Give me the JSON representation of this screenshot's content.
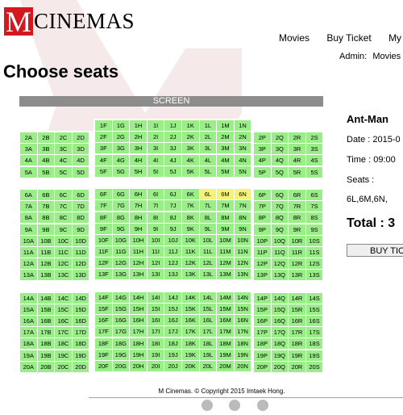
{
  "brand": {
    "logo_letter": "M",
    "logo_text": "CINEMAS",
    "accent": "#d4181f"
  },
  "nav": {
    "items": [
      "Movies",
      "Buy Ticket",
      "My Pa"
    ]
  },
  "admin": {
    "label": "Admin:",
    "link": "Movies"
  },
  "page": {
    "title": "Choose seats",
    "screen_label": "SCREEN"
  },
  "seat_colors": {
    "available": "#99ee88",
    "selected": "#f5f27a"
  },
  "seats": {
    "left_cols": [
      "A",
      "B",
      "C",
      "D"
    ],
    "center_cols": [
      "E",
      "F",
      "G",
      "H",
      "I",
      "J",
      "K",
      "L",
      "M",
      "N"
    ],
    "right_cols": [
      "P",
      "Q",
      "R",
      "S"
    ],
    "row_count": 20,
    "selected": [
      "6L",
      "6M",
      "6N"
    ]
  },
  "booking": {
    "movie": "Ant-Man",
    "date": "Date : 2015-0",
    "time": "Time : 09:00",
    "seats_label": "Seats :",
    "seats_value": "6L,6M,6N,",
    "total": "Total : 3",
    "buy_button": "BUY TIC"
  },
  "footer": {
    "text": "M Cinemas. © Copyright 2015 Imtaek Hong."
  }
}
